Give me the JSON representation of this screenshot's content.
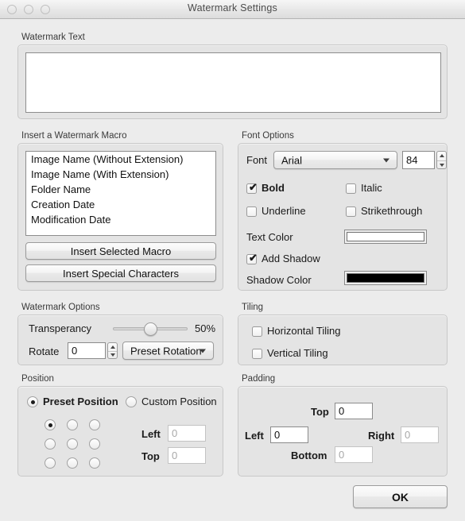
{
  "window": {
    "title": "Watermark Settings",
    "traffic_lights": [
      "close",
      "minimize",
      "zoom"
    ]
  },
  "watermark_text": {
    "group_label": "Watermark Text",
    "value": "",
    "placeholder": ""
  },
  "macro": {
    "group_label": "Insert a Watermark Macro",
    "items": [
      "Image Name (Without Extension)",
      "Image Name (With Extension)",
      "Folder Name",
      "Creation Date",
      "Modification Date"
    ],
    "insert_macro_label": "Insert Selected Macro",
    "insert_special_label": "Insert Special Characters"
  },
  "font_options": {
    "group_label": "Font Options",
    "font_label": "Font",
    "font_value": "Arial",
    "size_value": "84",
    "bold_label": "Bold",
    "bold_checked": true,
    "italic_label": "Italic",
    "italic_checked": false,
    "underline_label": "Underline",
    "underline_checked": false,
    "strikethrough_label": "Strikethrough",
    "strikethrough_checked": false,
    "text_color_label": "Text Color",
    "text_color_value": "#ffffff",
    "add_shadow_label": "Add Shadow",
    "add_shadow_checked": true,
    "shadow_color_label": "Shadow Color",
    "shadow_color_value": "#000000",
    "check_glyph": "✔"
  },
  "watermark_options": {
    "group_label": "Watermark Options",
    "transparency_label": "Transperancy",
    "transparency_value": "50%",
    "transparency_percent": 50,
    "rotate_label": "Rotate",
    "rotate_value": "0",
    "preset_rotation_value": "Preset Rotation"
  },
  "tiling": {
    "group_label": "Tiling",
    "horizontal_label": "Horizontal Tiling",
    "horizontal_checked": false,
    "vertical_label": "Vertical Tiling",
    "vertical_checked": false
  },
  "position": {
    "group_label": "Position",
    "preset_label": "Preset Position",
    "preset_selected": true,
    "custom_label": "Custom Position",
    "custom_selected": false,
    "grid_selected_index": 0,
    "left_label": "Left",
    "left_value": "0",
    "top_label": "Top",
    "top_value": "0"
  },
  "padding": {
    "group_label": "Padding",
    "top_label": "Top",
    "top_value": "0",
    "left_label": "Left",
    "left_value": "0",
    "right_label": "Right",
    "right_value": "0",
    "bottom_label": "Bottom",
    "bottom_value": "0"
  },
  "footer": {
    "ok_label": "OK"
  }
}
